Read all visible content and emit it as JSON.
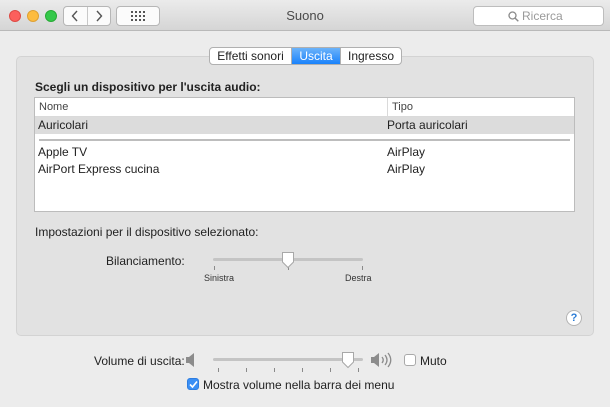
{
  "window": {
    "title": "Suono"
  },
  "search": {
    "placeholder": "Ricerca"
  },
  "tabs": [
    {
      "label": "Effetti sonori",
      "selected": false
    },
    {
      "label": "Uscita",
      "selected": true
    },
    {
      "label": "Ingresso",
      "selected": false
    }
  ],
  "output": {
    "heading": "Scegli un dispositivo per l'uscita audio:",
    "columns": {
      "name": "Nome",
      "type": "Tipo"
    },
    "devices": [
      {
        "name": "Auricolari",
        "type": "Porta auricolari",
        "selected": true
      },
      {
        "name": "Apple TV",
        "type": "AirPlay",
        "selected": false
      },
      {
        "name": "AirPort Express cucina",
        "type": "AirPlay",
        "selected": false
      }
    ]
  },
  "settings": {
    "heading": "Impostazioni per il dispositivo selezionato:",
    "balance_label": "Bilanciamento:",
    "balance_left": "Sinistra",
    "balance_right": "Destra",
    "balance_value": 0.5
  },
  "volume": {
    "label": "Volume di uscita:",
    "value": 0.9,
    "mute_label": "Muto",
    "mute_checked": false,
    "show_in_menubar_label": "Mostra volume nella barra dei menu",
    "show_in_menubar_checked": true
  },
  "colors": {
    "accent": "#1a82fb",
    "selected_row": "#dcdcdc"
  },
  "icons": [
    "back-icon",
    "forward-icon",
    "grid-icon",
    "search-icon",
    "help-icon",
    "speaker-low-icon",
    "speaker-high-icon",
    "checkmark-icon"
  ]
}
